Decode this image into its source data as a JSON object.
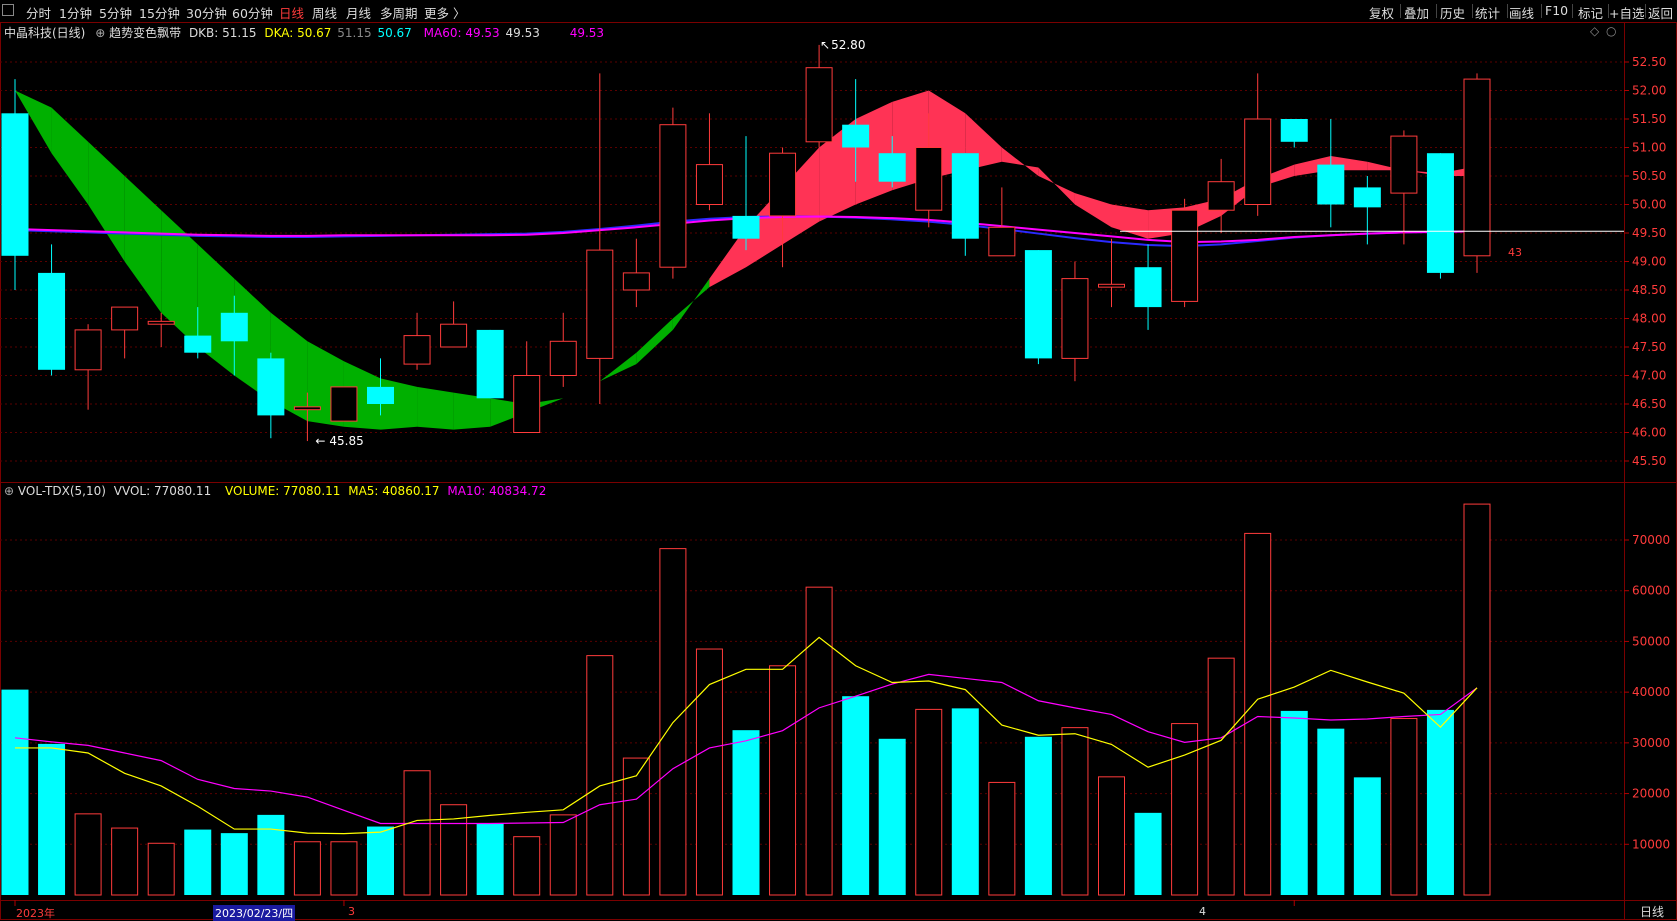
{
  "toolbar": {
    "periods": [
      "分时",
      "1分钟",
      "5分钟",
      "15分钟",
      "30分钟",
      "60分钟",
      "日线",
      "周线",
      "月线",
      "多周期",
      "更多 〉"
    ],
    "active_period": "日线",
    "right_buttons": [
      "复权",
      "叠加",
      "历史",
      "统计",
      "画线",
      "F10",
      "标记",
      "+自选",
      "返回"
    ]
  },
  "main_panel": {
    "stock_name": "中晶科技(日线)",
    "indicator_name": "趋势变色飘带",
    "dkb": "DKB: 51.15",
    "dka": "DKA: 50.67",
    "dka2": "51.15",
    "dka3": "50.67",
    "ma60": "MA60: 49.53",
    "ma60b": "49.53",
    "ma60c": "49.53",
    "high_label": "52.80",
    "low_label": "45.85",
    "crosshair_value": "43",
    "y_ticks": [
      "52.50",
      "52.00",
      "51.50",
      "51.00",
      "50.50",
      "50.00",
      "49.50",
      "49.00",
      "48.50",
      "48.00",
      "47.50",
      "47.00",
      "46.50",
      "46.00",
      "45.50"
    ]
  },
  "volume_panel": {
    "title": "VOL-TDX(5,10)",
    "vvol": "VVOL: 77080.11",
    "volume": "VOLUME: 77080.11",
    "ma5": "MA5: 40860.17",
    "ma10": "MA10: 40834.72",
    "y_ticks": [
      "70000",
      "60000",
      "50000",
      "40000",
      "30000",
      "20000",
      "10000"
    ]
  },
  "x_axis": {
    "year_label": "2023年",
    "cursor_date": "2023/02/23/四",
    "month3": "3",
    "month4": "4",
    "period_label": "日线"
  },
  "colors": {
    "up": "#ff3b3b",
    "down": "#00ffff",
    "ribbon_up": "#ff3355",
    "ribbon_down": "#00b000",
    "ma60": "#ff00ff",
    "blue_line": "#2a2aff",
    "ma5": "#ffff00",
    "ma10": "#ff00ff"
  },
  "chart_data": [
    {
      "type": "candlestick",
      "title": "中晶科技(日线)",
      "ylim": [
        45.3,
        52.8
      ],
      "candles": [
        {
          "o": 51.6,
          "h": 52.2,
          "l": 48.5,
          "c": 49.1
        },
        {
          "o": 48.8,
          "h": 49.3,
          "l": 47.0,
          "c": 47.1
        },
        {
          "o": 47.1,
          "h": 47.9,
          "l": 46.4,
          "c": 47.8
        },
        {
          "o": 47.8,
          "h": 48.2,
          "l": 47.3,
          "c": 48.2
        },
        {
          "o": 47.9,
          "h": 48.1,
          "l": 47.5,
          "c": 47.95
        },
        {
          "o": 47.7,
          "h": 48.2,
          "l": 47.3,
          "c": 47.4
        },
        {
          "o": 48.1,
          "h": 48.4,
          "l": 47.0,
          "c": 47.6
        },
        {
          "o": 47.3,
          "h": 47.4,
          "l": 45.9,
          "c": 46.3
        },
        {
          "o": 46.4,
          "h": 46.7,
          "l": 45.85,
          "c": 46.45
        },
        {
          "o": 46.2,
          "h": 46.8,
          "l": 46.2,
          "c": 46.8
        },
        {
          "o": 46.8,
          "h": 47.3,
          "l": 46.3,
          "c": 46.5
        },
        {
          "o": 47.2,
          "h": 48.1,
          "l": 47.1,
          "c": 47.7
        },
        {
          "o": 47.5,
          "h": 48.3,
          "l": 47.5,
          "c": 47.9
        },
        {
          "o": 47.8,
          "h": 47.8,
          "l": 46.6,
          "c": 46.6
        },
        {
          "o": 46.0,
          "h": 47.6,
          "l": 46.0,
          "c": 47.0
        },
        {
          "o": 47.0,
          "h": 48.1,
          "l": 46.8,
          "c": 47.6
        },
        {
          "o": 47.3,
          "h": 52.3,
          "l": 46.5,
          "c": 49.2
        },
        {
          "o": 48.5,
          "h": 49.4,
          "l": 48.2,
          "c": 48.8
        },
        {
          "o": 48.9,
          "h": 51.7,
          "l": 48.7,
          "c": 51.4
        },
        {
          "o": 50.0,
          "h": 51.6,
          "l": 49.9,
          "c": 50.7
        },
        {
          "o": 49.8,
          "h": 51.2,
          "l": 49.2,
          "c": 49.4
        },
        {
          "o": 49.8,
          "h": 51.0,
          "l": 48.9,
          "c": 50.9
        },
        {
          "o": 51.1,
          "h": 52.8,
          "l": 51.0,
          "c": 52.4
        },
        {
          "o": 51.4,
          "h": 52.2,
          "l": 50.4,
          "c": 51.0
        },
        {
          "o": 50.9,
          "h": 51.2,
          "l": 50.3,
          "c": 50.4
        },
        {
          "o": 49.9,
          "h": 51.6,
          "l": 49.6,
          "c": 51.0
        },
        {
          "o": 50.9,
          "h": 50.9,
          "l": 49.1,
          "c": 49.4
        },
        {
          "o": 49.1,
          "h": 50.3,
          "l": 49.1,
          "c": 49.6
        },
        {
          "o": 49.2,
          "h": 49.2,
          "l": 47.2,
          "c": 47.3
        },
        {
          "o": 47.3,
          "h": 49.0,
          "l": 46.9,
          "c": 48.7
        },
        {
          "o": 48.55,
          "h": 49.4,
          "l": 48.2,
          "c": 48.6
        },
        {
          "o": 48.9,
          "h": 49.3,
          "l": 47.8,
          "c": 48.2
        },
        {
          "o": 48.3,
          "h": 50.1,
          "l": 48.2,
          "c": 49.9
        },
        {
          "o": 49.9,
          "h": 50.8,
          "l": 49.5,
          "c": 50.4
        },
        {
          "o": 50.0,
          "h": 52.3,
          "l": 49.8,
          "c": 51.5
        },
        {
          "o": 51.5,
          "h": 51.5,
          "l": 51.0,
          "c": 51.1
        },
        {
          "o": 50.7,
          "h": 51.5,
          "l": 49.6,
          "c": 50.0
        },
        {
          "o": 50.3,
          "h": 50.5,
          "l": 49.3,
          "c": 49.95
        },
        {
          "o": 50.2,
          "h": 51.3,
          "l": 49.3,
          "c": 51.2
        },
        {
          "o": 50.9,
          "h": 50.9,
          "l": 48.7,
          "c": 48.8
        },
        {
          "o": 49.1,
          "h": 52.3,
          "l": 48.8,
          "c": 52.2
        }
      ],
      "ma60": [
        49.57,
        49.55,
        49.53,
        49.51,
        49.49,
        49.47,
        49.46,
        49.45,
        49.45,
        49.46,
        49.46,
        49.46,
        49.46,
        49.46,
        49.47,
        49.5,
        49.55,
        49.6,
        49.66,
        49.72,
        49.76,
        49.78,
        49.79,
        49.78,
        49.76,
        49.73,
        49.68,
        49.62,
        49.56,
        49.5,
        49.44,
        49.38,
        49.34,
        49.35,
        49.38,
        49.43,
        49.46,
        49.49,
        49.51,
        49.52,
        49.53
      ],
      "blue_line": [
        49.55,
        49.53,
        49.51,
        49.49,
        49.47,
        49.45,
        49.44,
        49.43,
        49.43,
        49.44,
        49.45,
        49.46,
        49.47,
        49.48,
        49.49,
        49.52,
        49.57,
        49.63,
        49.7,
        49.75,
        49.78,
        49.79,
        49.79,
        49.77,
        49.74,
        49.7,
        49.64,
        49.57,
        49.49,
        49.41,
        49.34,
        49.29,
        49.27,
        49.3,
        49.36,
        49.42,
        49.46,
        49.49,
        49.51,
        49.52,
        49.53
      ],
      "ribbon_a": [
        52.0,
        50.9,
        50.0,
        49.0,
        48.1,
        47.5,
        47.0,
        46.55,
        46.2,
        46.1,
        46.05,
        46.1,
        46.05,
        46.1,
        46.35,
        46.6,
        46.9,
        47.4,
        48.0,
        48.55,
        48.9,
        49.3,
        49.7,
        50.0,
        50.25,
        50.45,
        50.6,
        50.75,
        50.65,
        50.0,
        49.6,
        49.4,
        49.5,
        49.8,
        50.3,
        50.5,
        50.6,
        50.6,
        50.6,
        50.5,
        50.5
      ],
      "ribbon_b": [
        52.0,
        51.7,
        51.1,
        50.5,
        49.9,
        49.3,
        48.7,
        48.1,
        47.6,
        47.25,
        46.95,
        46.8,
        46.7,
        46.6,
        46.5,
        46.6,
        46.9,
        47.2,
        47.8,
        48.7,
        49.6,
        50.3,
        51.0,
        51.5,
        51.8,
        52.0,
        51.6,
        51.0,
        50.5,
        50.2,
        50.0,
        49.9,
        49.95,
        50.1,
        50.45,
        50.7,
        50.85,
        50.75,
        50.6,
        50.55,
        50.67
      ]
    },
    {
      "type": "bar",
      "title": "VOL-TDX(5,10)",
      "ylim": [
        0,
        77080
      ],
      "volumes": [
        40500,
        29800,
        16000,
        13200,
        10200,
        12900,
        12200,
        15800,
        10500,
        10500,
        13500,
        24500,
        17800,
        14200,
        11500,
        15800,
        47200,
        27000,
        68300,
        48500,
        32500,
        45200,
        60700,
        39200,
        30800,
        36600,
        36800,
        22200,
        31200,
        33000,
        23300,
        16200,
        33800,
        46700,
        71300,
        36300,
        32800,
        23200,
        34800,
        36500,
        77080
      ],
      "ma5": [
        29000,
        29000,
        28000,
        24000,
        21500,
        17500,
        13000,
        13000,
        12200,
        12100,
        12400,
        14700,
        15000,
        15700,
        16300,
        16800,
        21500,
        23500,
        34000,
        41500,
        44500,
        44500,
        50800,
        45200,
        41900,
        42200,
        40500,
        33500,
        31500,
        31800,
        29700,
        25200,
        27600,
        30500,
        38600,
        41000,
        44300,
        42000,
        39800,
        33100,
        40860
      ],
      "ma10": [
        31000,
        30200,
        29500,
        28000,
        26500,
        22800,
        21000,
        20500,
        19300,
        16700,
        14100,
        14100,
        14100,
        14100,
        14200,
        14300,
        17800,
        18900,
        24900,
        29000,
        30400,
        32400,
        36900,
        39200,
        41600,
        43500,
        42700,
        41900,
        38300,
        36900,
        35600,
        32200,
        30100,
        31000,
        35200,
        34900,
        34500,
        34700,
        35200,
        35600,
        40834
      ]
    }
  ]
}
